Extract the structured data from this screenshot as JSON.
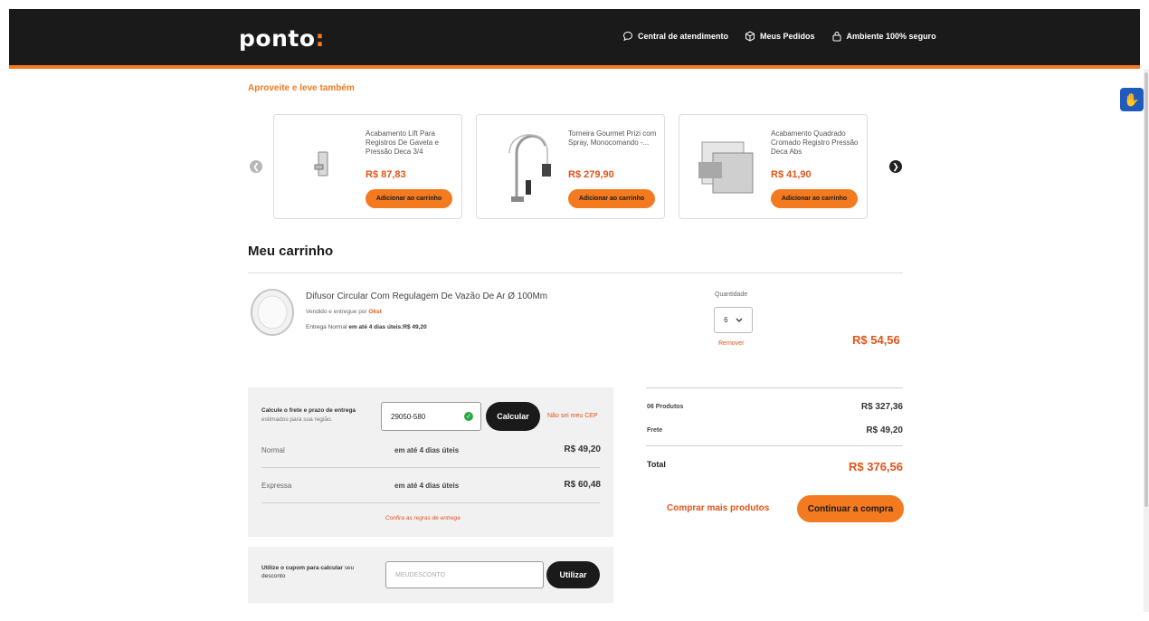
{
  "header": {
    "logo": "ponto",
    "logo_mark": ":",
    "links": [
      {
        "label": "Central de atendimento",
        "icon": "chat-bubble-icon"
      },
      {
        "label": "Meus Pedidos",
        "icon": "box-icon"
      },
      {
        "label": "Ambiente 100% seguro",
        "icon": "lock-icon"
      }
    ]
  },
  "colors": {
    "brand": "#f47a20",
    "price": "#e0541a",
    "header_bg": "#1a1a1a"
  },
  "carousel": {
    "title": "Aproveite e leve também",
    "items": [
      {
        "name": "Acabamento Lift Para Registros De Gaveta e Pressão Deca 3/4",
        "price": "R$ 87,83",
        "button": "Adicionar ao carrinho"
      },
      {
        "name": "Torneira Gourmet Prizi com Spray, Monocomando -...",
        "price": "R$ 279,90",
        "button": "Adicionar ao carrinho"
      },
      {
        "name": "Acabamento Quadrado Cromado Registro Pressão Deca Abs",
        "price": "R$ 41,90",
        "button": "Adicionar ao carrinho"
      }
    ]
  },
  "cart": {
    "title": "Meu carrinho",
    "item": {
      "name": "Difusor Circular Com Regulagem De Vazão De Ar Ø 100Mm",
      "seller_prefix": "Vendido e entregue por",
      "seller": "Olist",
      "shipping_prefix": "Entrega Normal",
      "shipping_bold": "em até 4 dias úteis:R$ 49,20",
      "qty_label": "Quantidade",
      "qty": "6",
      "remove": "Remover",
      "price": "R$ 54,56"
    }
  },
  "shipping": {
    "label": "Calcule o frete e prazo de entrega",
    "sub": "estimados para sua região.",
    "cep": "29050-580",
    "calc_button": "Calcular",
    "no_cep": "Não sei meu CEP",
    "options": [
      {
        "name": "Normal",
        "days": "em até 4 dias úteis",
        "price": "R$ 49,20"
      },
      {
        "name": "Expressa",
        "days": "em até 4 dias úteis",
        "price": "R$ 60,48"
      }
    ],
    "rules": "Confira as regras de entrega"
  },
  "coupon": {
    "label_bold": "Utilize o cupom para calcular",
    "label_rest": "seu desconto",
    "placeholder": "MEUDESCONTO",
    "button": "Utilizar"
  },
  "summary": {
    "products_label": "06 Produtos",
    "products_value": "R$ 327,36",
    "freight_label": "Frete",
    "freight_value": "R$ 49,20",
    "total_label": "Total",
    "total_value": "R$ 376,56",
    "more_button": "Comprar mais produtos",
    "continue_button": "Continuar a compra"
  }
}
